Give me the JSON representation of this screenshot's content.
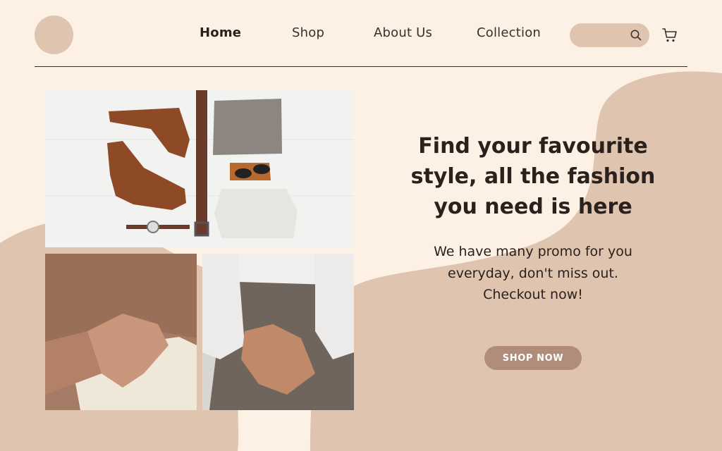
{
  "nav": {
    "items": [
      {
        "label": "Home",
        "active": true
      },
      {
        "label": "Shop",
        "active": false
      },
      {
        "label": "About Us",
        "active": false
      },
      {
        "label": "Collection",
        "active": false
      }
    ]
  },
  "search": {
    "icon": "search-icon"
  },
  "cart": {
    "icon": "cart-icon"
  },
  "hero": {
    "headline_lines": [
      "Find your favourite",
      "style, all the fashion",
      "you need is here"
    ],
    "subtext_lines": [
      "We have many promo for you",
      "everyday, don't miss out.",
      "Checkout now!"
    ],
    "cta_label": "SHOP NOW"
  },
  "colors": {
    "background": "#fdf1e6",
    "blob": "#dfc4b0",
    "button": "#b08d7a",
    "text": "#2b211c"
  }
}
